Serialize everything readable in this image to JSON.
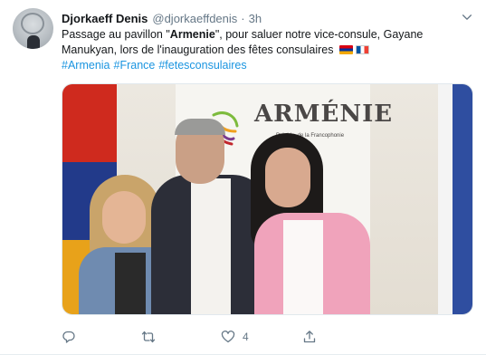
{
  "tweet": {
    "display_name": "Djorkaeff Denis",
    "handle": "@djorkaeffdenis",
    "separator": "·",
    "time": "3h",
    "text_before_bold": "Passage au pavillon \"",
    "text_bold": "Armenie",
    "text_after_bold": "\", pour saluer notre vice-consule, Gayane Manukyan, lors de l'inauguration des fêtes consulaires",
    "flags": [
      "flag-armenia-icon",
      "flag-france-icon"
    ],
    "hashtags": [
      "#Armenia",
      "#France",
      "#fetesconsulaires"
    ]
  },
  "photo": {
    "sign_title": "ARMÉNIE",
    "sign_subtitle": "Présid... de la Francophonie"
  },
  "actions": {
    "reply": {
      "icon": "reply-icon",
      "count": ""
    },
    "retweet": {
      "icon": "retweet-icon",
      "count": ""
    },
    "like": {
      "icon": "heart-icon",
      "count": "4"
    },
    "share": {
      "icon": "share-icon",
      "count": ""
    }
  },
  "colors": {
    "link": "#1b95e0",
    "muted": "#657786",
    "text": "#14171a"
  }
}
